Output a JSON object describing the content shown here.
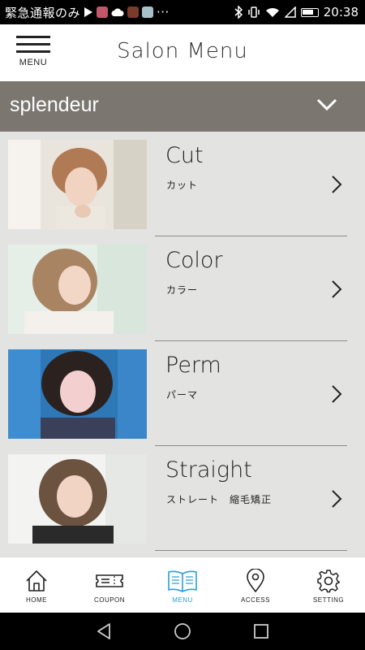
{
  "status_bar": {
    "emergency_text": "緊急通報のみ",
    "time": "20:38",
    "more": "···"
  },
  "header": {
    "menu_label": "MENU",
    "title": "Salon Menu"
  },
  "salon": {
    "name": "splendeur"
  },
  "menu_items": [
    {
      "title": "Cut",
      "subtitle": "カット"
    },
    {
      "title": "Color",
      "subtitle": "カラー"
    },
    {
      "title": "Perm",
      "subtitle": "パーマ"
    },
    {
      "title": "Straight",
      "subtitle": "ストレート　縮毛矯正"
    }
  ],
  "tabs": [
    {
      "label": "HOME",
      "icon": "home-icon"
    },
    {
      "label": "COUPON",
      "icon": "coupon-icon"
    },
    {
      "label": "MENU",
      "icon": "book-icon",
      "active": true
    },
    {
      "label": "ACCESS",
      "icon": "map-pin-icon"
    },
    {
      "label": "SETTING",
      "icon": "gear-icon"
    }
  ],
  "colors": {
    "accent": "#2aa0d6",
    "salon_bar": "#7b7770",
    "background": "#e3e3e1"
  }
}
